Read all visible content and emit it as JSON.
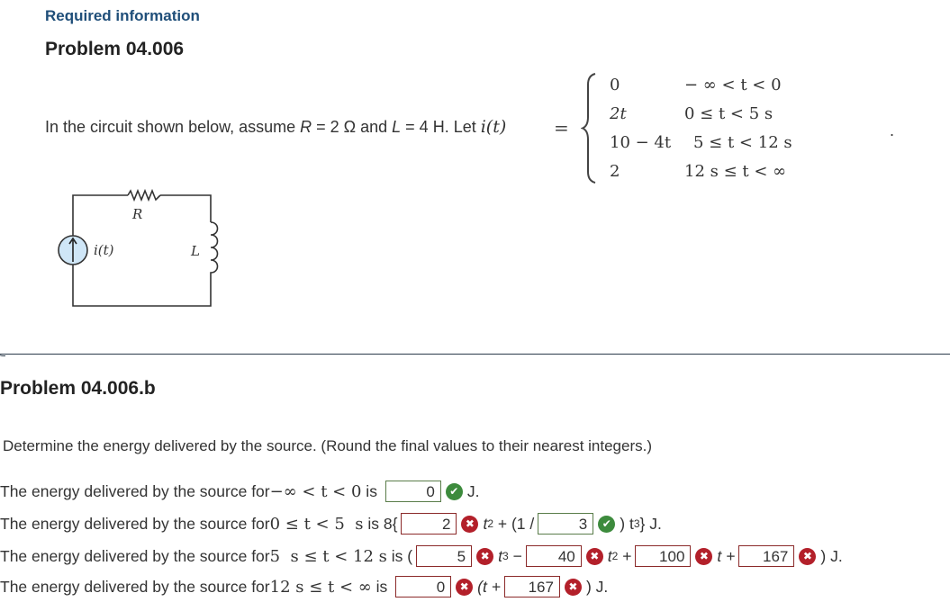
{
  "header": {
    "required_label": "Required information",
    "problem_title": "Problem 04.006"
  },
  "intro": {
    "text_a": "In the circuit shown below, assume ",
    "R_sym": "R",
    "R_val": " = 2 Ω and ",
    "L_sym": "L",
    "L_val": " = 4 H. Let ",
    "it": "i(t)",
    "equals": "=",
    "period": "."
  },
  "piecewise": [
    {
      "value": "0",
      "condition": "− ∞  <  t  <  0"
    },
    {
      "value": "2t",
      "condition": "0  ≤  t  <  5 s"
    },
    {
      "value": "10  −  4t",
      "condition": "5  ≤  t  <  12 s"
    },
    {
      "value": "2",
      "condition": "12 s  ≤  t  <  ∞"
    }
  ],
  "circuit": {
    "resistor_label": "R",
    "source_label": "i(t)",
    "inductor_label": "L"
  },
  "part_b": {
    "title": "Problem 04.006.b",
    "instruction": "Determine the energy delivered by the source. (Round the final values to their nearest integers.)",
    "rows": [
      {
        "prefix": "The energy delivered by the source for ",
        "range": "−∞ < t < 0",
        "is": " is ",
        "answers": [
          {
            "value": "0",
            "status": "correct"
          }
        ],
        "suffix": "J."
      },
      {
        "prefix": "The energy delivered by the source for ",
        "range": "0 ≤ t < 5  s",
        "is": " is 8{",
        "answers": [
          {
            "value": "2",
            "status": "incorrect"
          },
          {
            "value": "3",
            "status": "correct"
          }
        ],
        "between_1": "t",
        "between_1_exp": "2",
        "between_1_tail": " + (1 /",
        "tail": ") t",
        "tail_exp": "3",
        "suffix": "} J."
      },
      {
        "prefix": "The energy delivered by the source for ",
        "range": "5  s ≤ t < 12 s",
        "is": " is (",
        "answers": [
          {
            "value": "5",
            "status": "incorrect"
          },
          {
            "value": "40",
            "status": "incorrect"
          },
          {
            "value": "100",
            "status": "incorrect"
          },
          {
            "value": "167",
            "status": "incorrect"
          }
        ],
        "term_1": "t",
        "term_1_exp": "3",
        "term_1_op": " −",
        "term_2": "t",
        "term_2_exp": "2",
        "term_2_op": " +",
        "term_3": "t +",
        "suffix": ") J."
      },
      {
        "prefix": "The energy delivered by the source for ",
        "range": "12 s ≤ t < ∞",
        "is": " is ",
        "answers": [
          {
            "value": "0",
            "status": "incorrect"
          },
          {
            "value": "167",
            "status": "incorrect"
          }
        ],
        "mid": "(t +",
        "suffix": ") J."
      }
    ]
  },
  "icons": {
    "correct": "✔",
    "incorrect": "✖"
  },
  "colors": {
    "heading_blue": "#1f4e79",
    "correct_green": "#3d8b3d",
    "incorrect_red": "#b3202a",
    "source_fill": "#cfe6f7"
  }
}
